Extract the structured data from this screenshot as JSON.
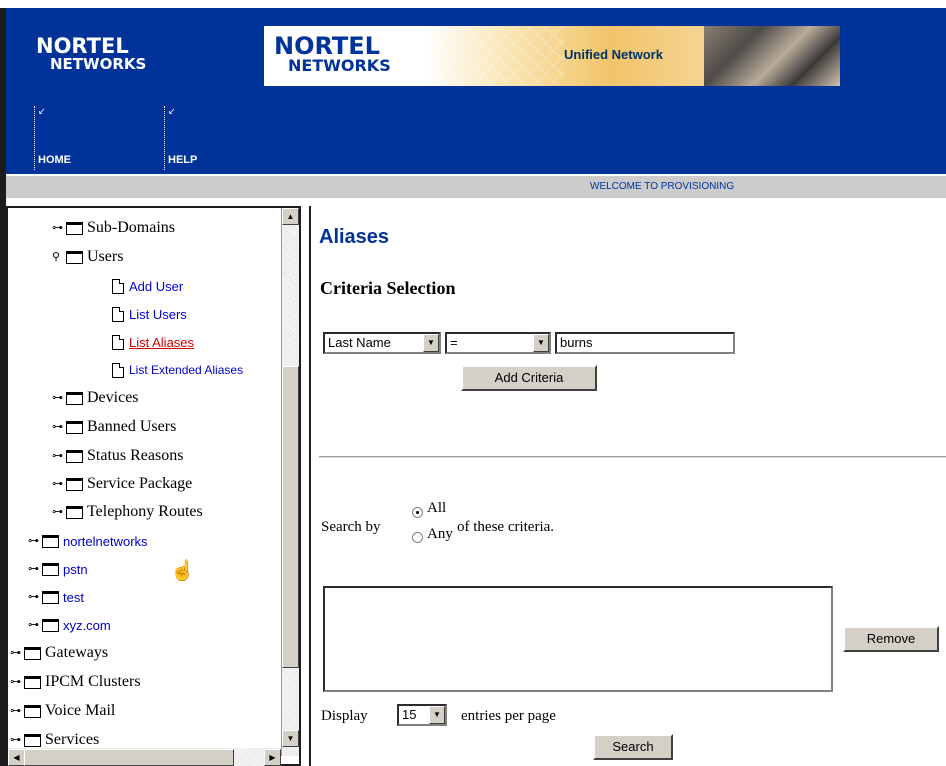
{
  "header": {
    "logo_line1": "NORTEL",
    "logo_line2": "NETWORKS",
    "banner": {
      "logo_line1": "NORTEL",
      "logo_line2": "NETWORKS",
      "tagline": "Unified Network"
    },
    "nav": [
      {
        "label": "HOME"
      },
      {
        "label": "HELP"
      }
    ]
  },
  "welcome_text": "WELCOME TO PROVISIONING",
  "tree": {
    "items": [
      {
        "label": "Sub-Domains"
      },
      {
        "label": "Users"
      },
      {
        "label": "Add User"
      },
      {
        "label": "List Users"
      },
      {
        "label": "List Aliases"
      },
      {
        "label": "List Extended Aliases"
      },
      {
        "label": "Devices"
      },
      {
        "label": "Banned Users"
      },
      {
        "label": "Status Reasons"
      },
      {
        "label": "Service Package"
      },
      {
        "label": "Telephony Routes"
      },
      {
        "label": "nortelnetworks"
      },
      {
        "label": "pstn"
      },
      {
        "label": "test"
      },
      {
        "label": "xyz.com"
      },
      {
        "label": "Gateways"
      },
      {
        "label": "IPCM Clusters"
      },
      {
        "label": "Voice Mail"
      },
      {
        "label": "Services"
      }
    ]
  },
  "main": {
    "title": "Aliases",
    "criteria_heading": "Criteria Selection",
    "field_select": "Last Name",
    "operator_select": "=",
    "value_input": "burns",
    "add_criteria_label": "Add Criteria",
    "search_by_label": "Search by",
    "option_all": "All",
    "option_any": "Any",
    "search_by_suffix": "of these criteria.",
    "remove_label": "Remove",
    "display_label": "Display",
    "page_size": "15",
    "entries_label": "entries per page",
    "search_label": "Search"
  }
}
